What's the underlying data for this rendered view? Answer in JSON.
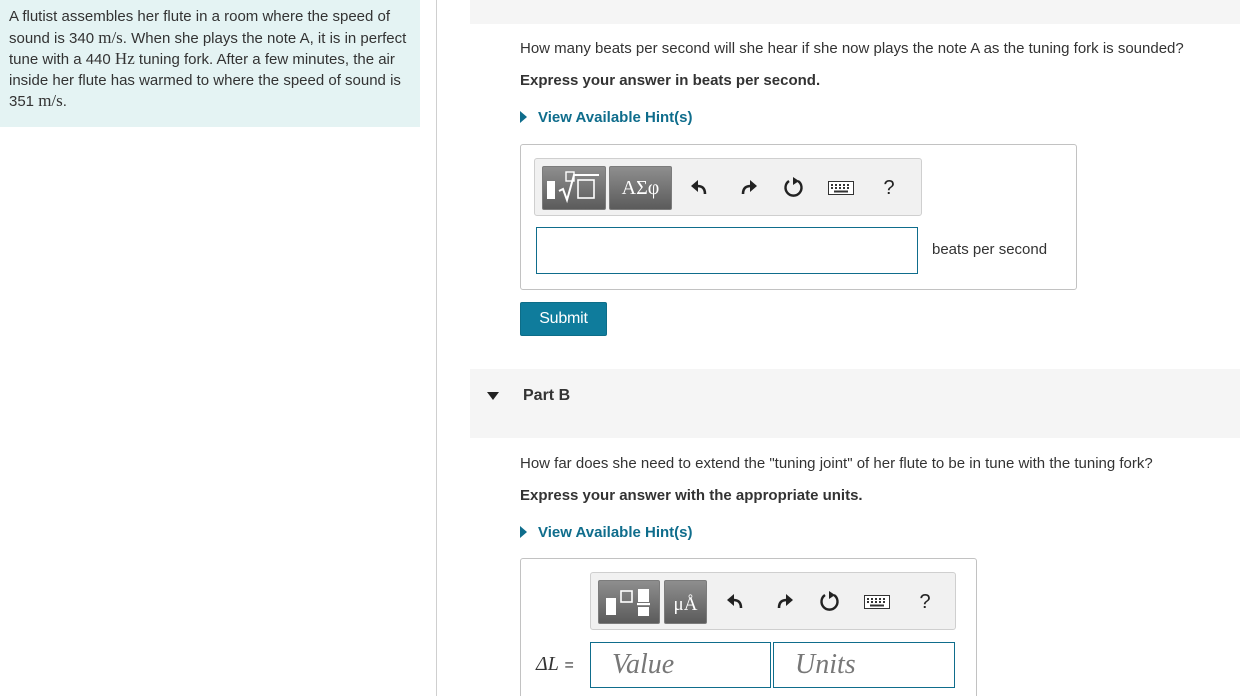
{
  "intro": {
    "t1": "A flutist assembles her flute in a room where the speed of sound is 340 ",
    "u1": "m/s",
    "t2": ". When she plays the note A, it is in perfect tune with a 440 ",
    "u2": "Hz",
    "t3": " tuning fork. After a few minutes, the air inside her flute has warmed to where the speed of sound is 351 ",
    "u3": "m/s",
    "t4": "."
  },
  "partA": {
    "question": "How many beats per second will she hear if she now plays the note A as the tuning fork is sounded?",
    "instruction": "Express your answer in beats per second.",
    "hint": "View Available Hint(s)",
    "toolbar": {
      "templates_icon": "radical-template-icon",
      "symbols_label": "ΑΣφ",
      "help_label": "?"
    },
    "answer_value": "",
    "unit_label": "beats per second",
    "submit_label": "Submit"
  },
  "partB": {
    "title": "Part B",
    "question": "How far does she need to extend the \"tuning joint\" of her flute to be in tune with the tuning fork?",
    "instruction": "Express your answer with the appropriate units.",
    "hint": "View Available Hint(s)",
    "toolbar": {
      "units_label": "μÅ",
      "help_label": "?"
    },
    "variable_label": "ΔL",
    "equals": "=",
    "value_placeholder": "Value",
    "units_placeholder": "Units"
  },
  "colors": {
    "accent": "#0f6d8c",
    "submit_bg": "#0f7c9c",
    "intro_bg": "#e4f3f3",
    "panel_bg": "#f5f5f5"
  }
}
